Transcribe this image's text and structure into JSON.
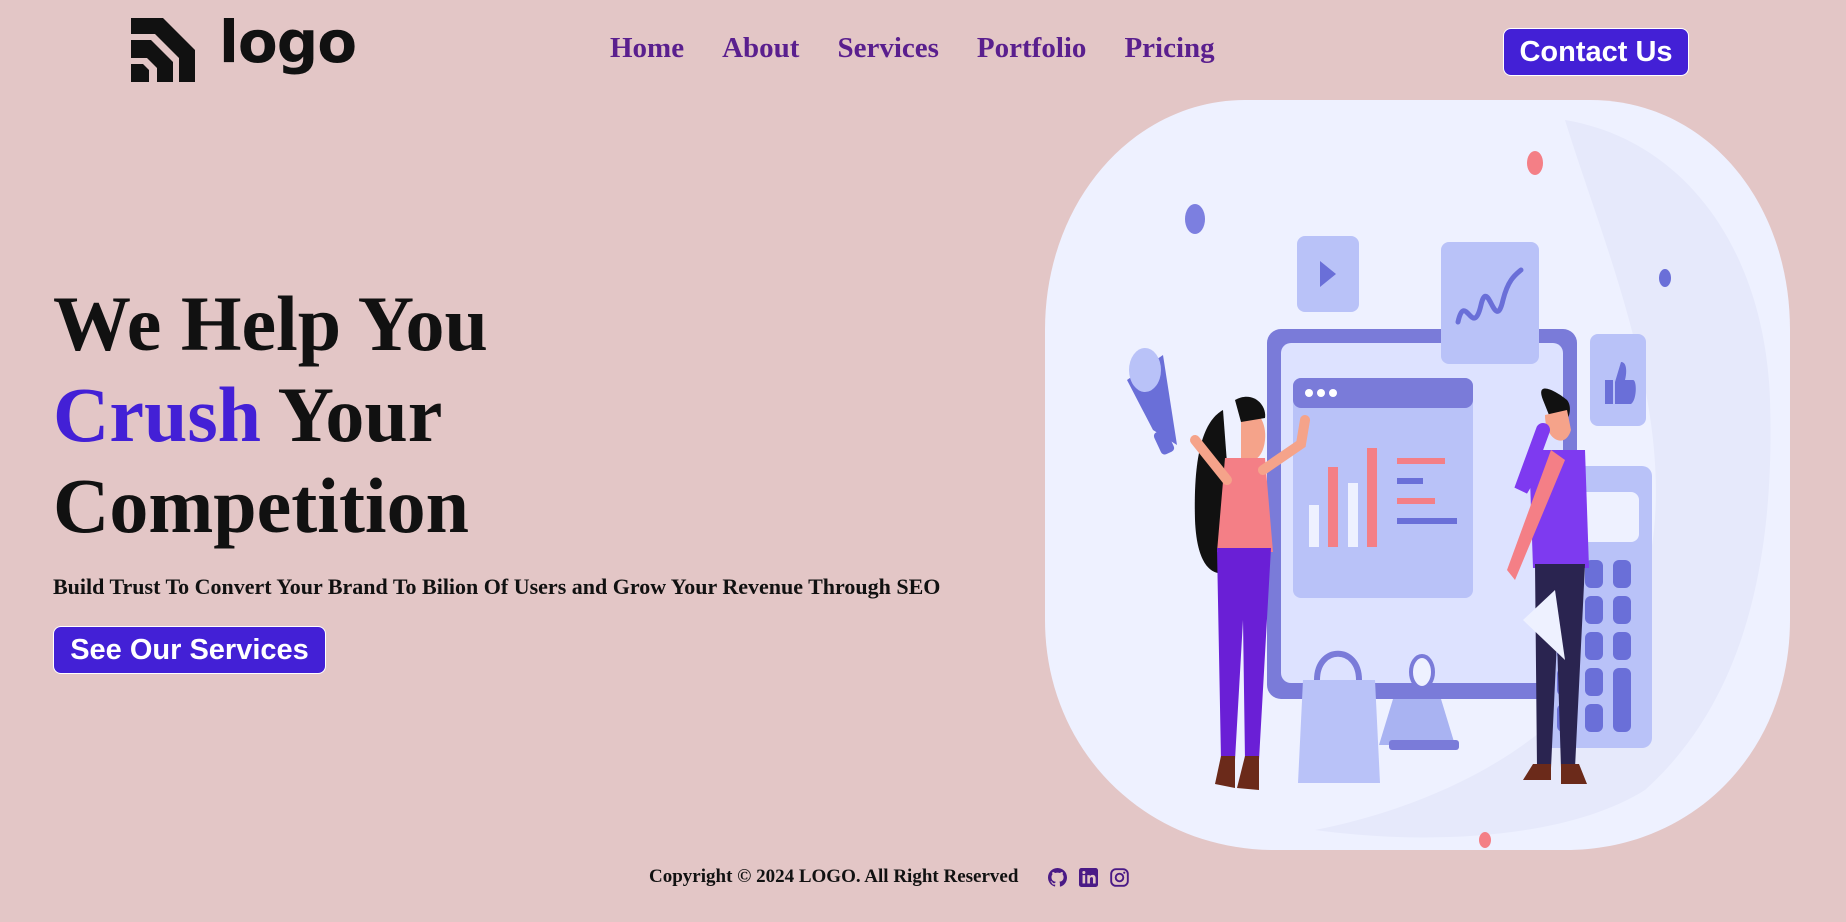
{
  "header": {
    "logo_text": "logo",
    "nav": [
      "Home",
      "About",
      "Services",
      "Portfolio",
      "Pricing"
    ],
    "contact_label": "Contact Us"
  },
  "hero": {
    "title_line1": "We Help You",
    "title_accent": "Crush",
    "title_line2_rest": " Your",
    "title_line3": "Competition",
    "subtitle": "Build Trust To Convert Your Brand To Bilion Of Users and Grow Your Revenue Through SEO",
    "cta_label": "See Our Services"
  },
  "footer": {
    "copyright": "Copyright © 2024 LOGO. All Right Reserved",
    "socials": [
      "github-icon",
      "linkedin-icon",
      "instagram-icon"
    ]
  },
  "colors": {
    "background": "#e3c6c6",
    "accent": "#4320d6",
    "nav": "#5a1f8e",
    "text": "#111111"
  }
}
